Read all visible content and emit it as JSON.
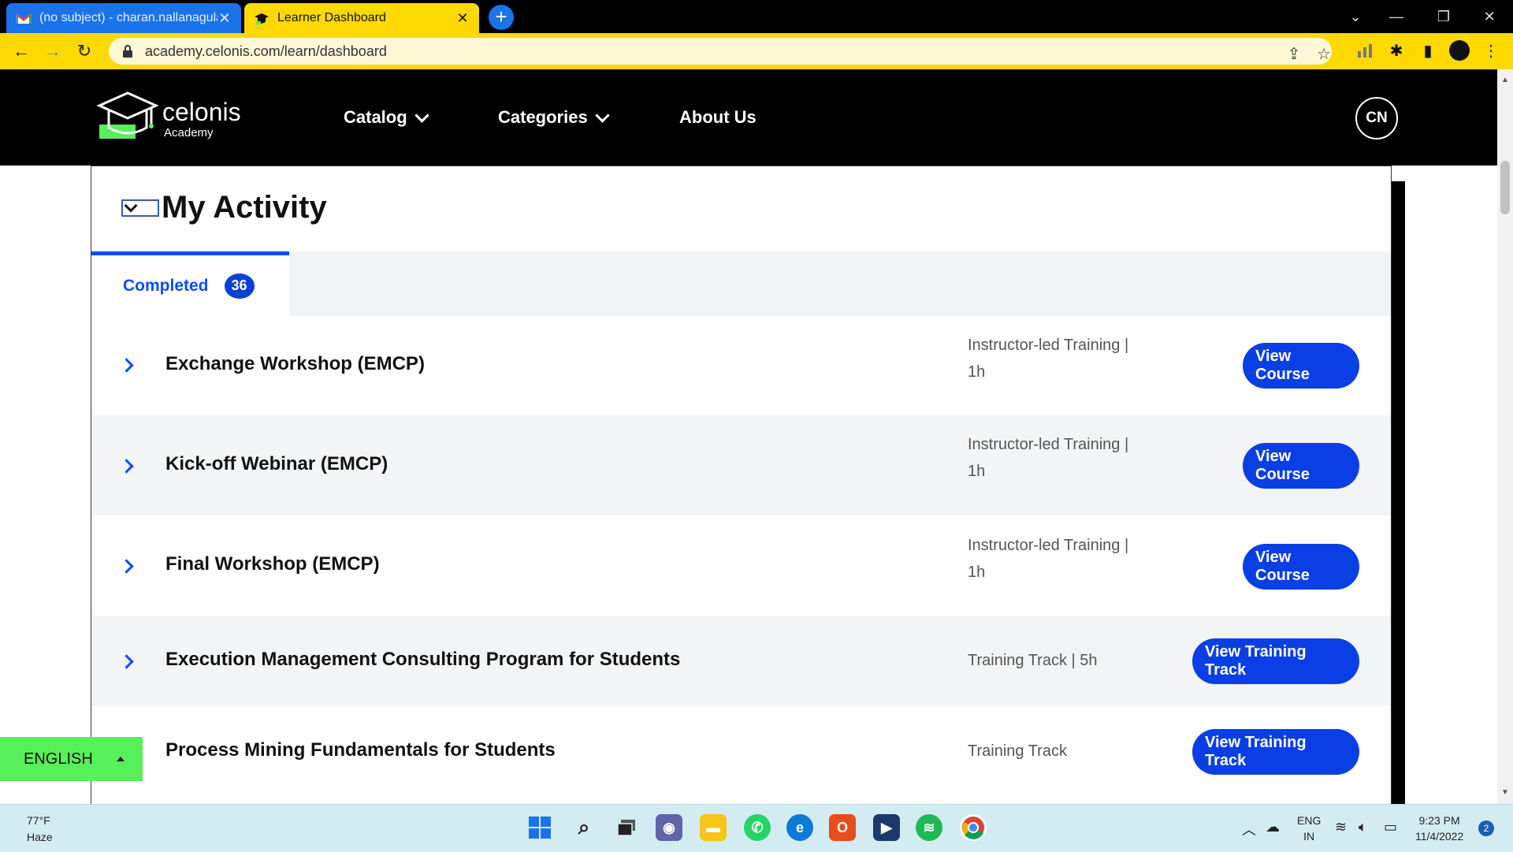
{
  "browser": {
    "tabs": [
      {
        "title": "(no subject) - charan.nallanagula",
        "close": "✕"
      },
      {
        "title": "Learner Dashboard",
        "close": "✕"
      }
    ],
    "new_tab": "+",
    "url": "academy.celonis.com/learn/dashboard"
  },
  "site": {
    "logo_text": "celonis",
    "logo_sub": "Academy",
    "nav": {
      "catalog": "Catalog",
      "categories": "Categories",
      "about": "About Us"
    },
    "avatar": "CN"
  },
  "activity": {
    "title": "My Activity",
    "tab_label": "Completed",
    "tab_count": "36",
    "rows": [
      {
        "title": "Exchange Workshop (EMCP)",
        "meta_line1": "Instructor-led Training |",
        "meta_line2": "1h",
        "button": "View Course"
      },
      {
        "title": "Kick-off Webinar (EMCP)",
        "meta_line1": "Instructor-led Training |",
        "meta_line2": "1h",
        "button": "View Course"
      },
      {
        "title": "Final Workshop (EMCP)",
        "meta_line1": "Instructor-led Training |",
        "meta_line2": "1h",
        "button": "View Course"
      },
      {
        "title": "Execution Management Consulting Program for Students",
        "meta_line1": "Training Track | 5h",
        "meta_line2": "",
        "button": "View Training Track"
      },
      {
        "title": "Process Mining Fundamentals for Students",
        "meta_line1": "Training Track",
        "meta_line2": "",
        "button": "View Training Track"
      }
    ]
  },
  "language": {
    "label": "ENGLISH"
  },
  "taskbar": {
    "temp": "77°F",
    "condition": "Haze",
    "lang_line1": "ENG",
    "lang_line2": "IN",
    "time": "9:23 PM",
    "date": "11/4/2022",
    "notifications": "2"
  },
  "colors": {
    "accent": "#0a3fe6",
    "browser_yellow": "#fdd900",
    "lang_green": "#57f05a"
  }
}
